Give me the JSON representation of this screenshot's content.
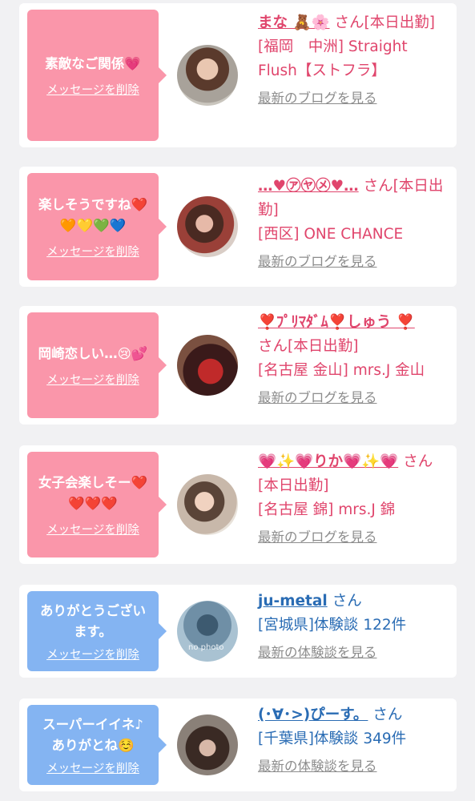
{
  "delete_label": "メッセージを削除",
  "cards": [
    {
      "bubble_text": "素敵なご関係💗",
      "name": "まな 🧸🌸",
      "suffix": "さん[本日出勤]",
      "shop": "[福岡　中洲] Straight Flush【ストフラ】",
      "link": "最新のブログを見る"
    },
    {
      "bubble_text": "楽しそうですね❤️🧡💛💚💙",
      "name": "…♥㋐㋳㋱♥…",
      "suffix": "さん[本日出勤]",
      "shop": "[西区] ONE CHANCE",
      "link": "最新のブログを見る"
    },
    {
      "bubble_text": "岡崎恋しい…😢💕",
      "name": "❣️ﾌﾟﾘﾏﾀﾞﾑ❣️しゅう ❣️",
      "suffix": "さん[本日出勤]",
      "shop": "[名古屋 金山] mrs.J 金山",
      "link": "最新のブログを見る"
    },
    {
      "bubble_text": "女子会楽しそー❤️❤️❤️❤️",
      "name": "💗✨💗りか💗✨💗",
      "suffix": "さん[本日出勤]",
      "shop": "[名古屋 錦] mrs.J 錦",
      "link": "最新のブログを見る"
    },
    {
      "bubble_text": "ありがとうございます。",
      "name": "ju-metal",
      "suffix": "さん",
      "shop": "[宮城県]体験談 122件",
      "link": "最新の体験談を見る",
      "avatar_caption": "no photo"
    },
    {
      "bubble_text": "スーパーイイネ♪ ありがとね☺️",
      "name": "(･∀･>)ぴーす。",
      "suffix": "さん",
      "shop": "[千葉県]体験談 349件",
      "link": "最新の体験談を見る"
    }
  ]
}
